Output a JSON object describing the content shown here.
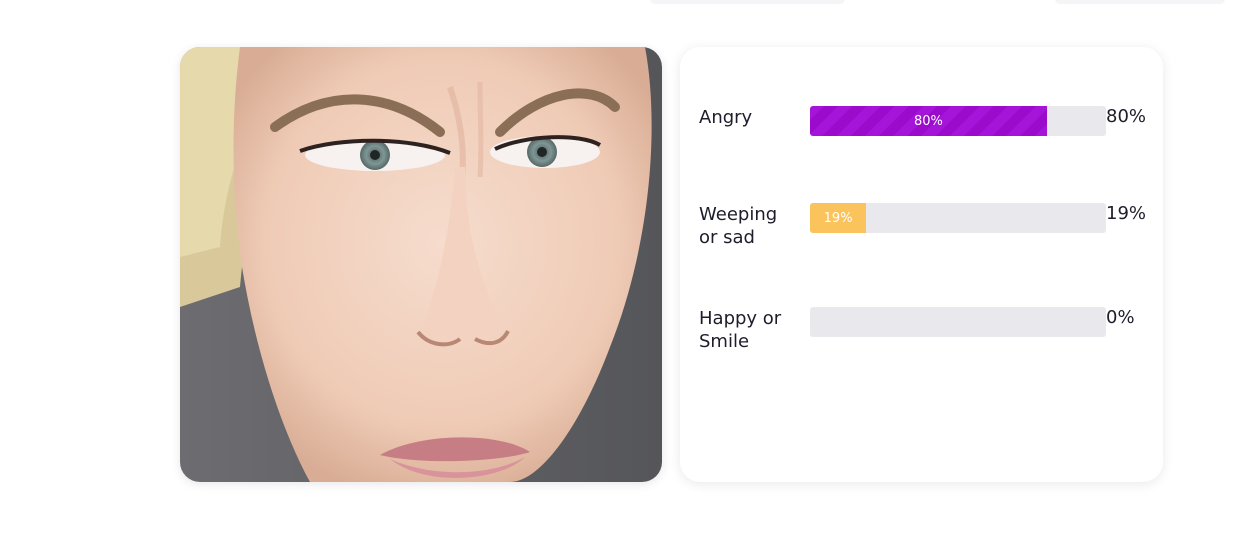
{
  "emotions": [
    {
      "label": "Angry",
      "percent": 80,
      "bar_text": "80%",
      "value_text": "80%",
      "color": "#a515d9"
    },
    {
      "label": "Weeping or sad",
      "percent": 19,
      "bar_text": "19%",
      "value_text": "19%",
      "color": "#fbc35c"
    },
    {
      "label": "Happy or Smile",
      "percent": 0,
      "bar_text": "",
      "value_text": "0%",
      "color": "#e8e8ed"
    }
  ]
}
